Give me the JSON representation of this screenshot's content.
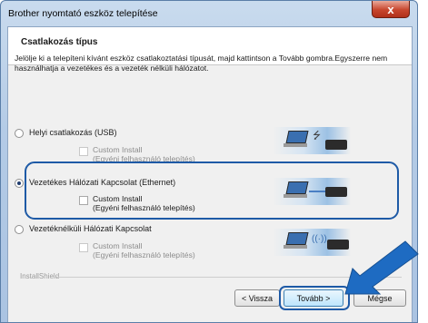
{
  "window": {
    "title": "Brother nyomtató eszköz telepítése",
    "close_glyph": "x"
  },
  "header": {
    "heading": "Csatlakozás típus"
  },
  "description": "Jelölje ki a telepíteni kívánt eszköz csatlakoztatási típusát, majd kattintson a Tovább gombra.Egyszerre nem használhatja a vezetékes és a vezeték nélküli hálózatot.",
  "options": [
    {
      "label": "Helyi csatlakozás (USB)",
      "selected": false,
      "custom_install": "Custom Install",
      "custom_install_sub": "(Egyéni felhasználó telepítés)",
      "custom_enabled": false,
      "image": "usb-connection-icon"
    },
    {
      "label": "Vezetékes Hálózati Kapcsolat (Ethernet)",
      "selected": true,
      "custom_install": "Custom Install",
      "custom_install_sub": "(Egyéni felhasználó telepítés)",
      "custom_enabled": true,
      "image": "ethernet-connection-icon"
    },
    {
      "label": "Vezetéknélküli Hálózati Kapcsolat",
      "selected": false,
      "custom_install": "Custom Install",
      "custom_install_sub": "(Egyéni felhasználó telepítés)",
      "custom_enabled": false,
      "image": "wireless-connection-icon"
    }
  ],
  "footer": {
    "installshield": "InstallShield",
    "back_label": "< Vissza",
    "next_label": "Tovább >",
    "cancel_label": "Mégse"
  },
  "colors": {
    "highlight": "#1e5aa6",
    "close": "#c7462d"
  }
}
